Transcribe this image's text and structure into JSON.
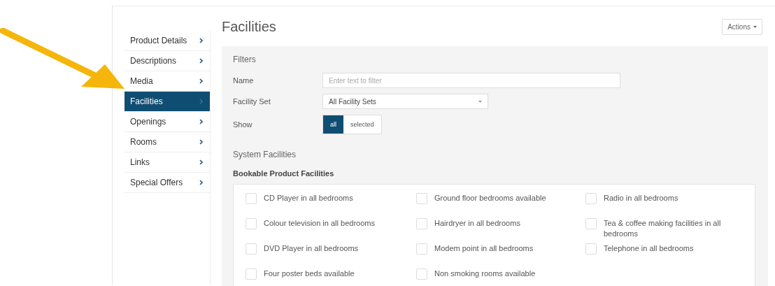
{
  "sidebar": {
    "items": [
      {
        "label": "Product Details",
        "selected": false
      },
      {
        "label": "Descriptions",
        "selected": false
      },
      {
        "label": "Media",
        "selected": false
      },
      {
        "label": "Facilities",
        "selected": true
      },
      {
        "label": "Openings",
        "selected": false
      },
      {
        "label": "Rooms",
        "selected": false
      },
      {
        "label": "Links",
        "selected": false
      },
      {
        "label": "Special Offers",
        "selected": false
      }
    ]
  },
  "page_title": "Facilities",
  "actions_button": {
    "label": "Actions"
  },
  "filters": {
    "heading": "Filters",
    "name": {
      "label": "Name",
      "placeholder": "Enter text to filter"
    },
    "facility_set": {
      "label": "Facility Set",
      "value": "All Facility Sets"
    },
    "show": {
      "label": "Show",
      "options": [
        {
          "label": "all",
          "selected": true
        },
        {
          "label": "selected",
          "selected": false
        }
      ]
    }
  },
  "system_facilities": {
    "heading": "System Facilities",
    "group_title": "Bookable Product Facilities",
    "columns": [
      [
        {
          "label": "CD Player in all bedrooms",
          "checked": false
        },
        {
          "label": "Colour television in all bedrooms",
          "checked": false
        },
        {
          "label": "DVD Player in all bedrooms",
          "checked": false
        },
        {
          "label": "Four poster beds available",
          "checked": false
        }
      ],
      [
        {
          "label": "Ground floor bedrooms available",
          "checked": false
        },
        {
          "label": "Hairdryer in all bedrooms",
          "checked": false
        },
        {
          "label": "Modem point in all bedrooms",
          "checked": false
        },
        {
          "label": "Non smoking rooms available",
          "checked": false
        }
      ],
      [
        {
          "label": "Radio in all bedrooms",
          "checked": false
        },
        {
          "label": "Tea & coffee making facilities in all bedrooms",
          "checked": false
        },
        {
          "label": "Telephone in all bedrooms",
          "checked": false
        }
      ]
    ]
  }
}
